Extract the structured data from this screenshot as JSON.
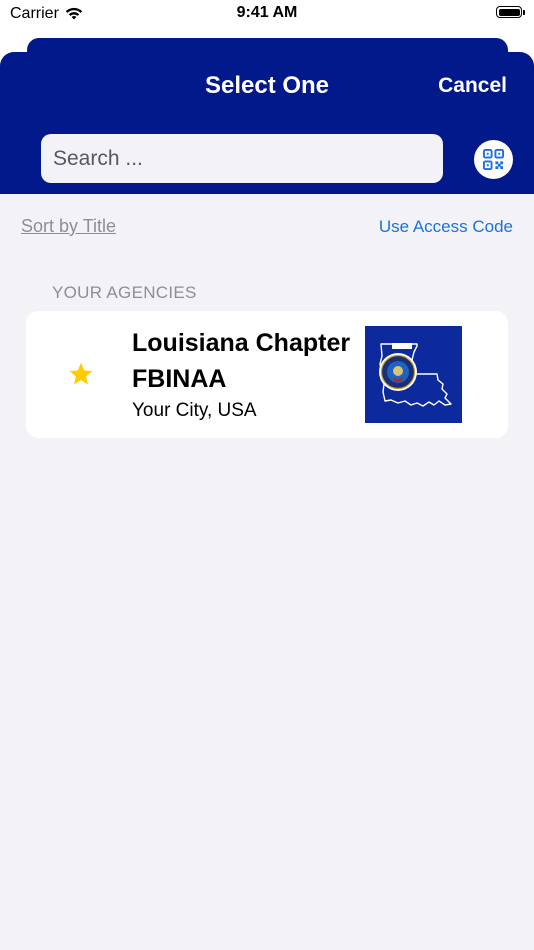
{
  "status_bar": {
    "carrier": "Carrier",
    "time": "9:41 AM",
    "icons": [
      "wifi-icon",
      "battery-icon"
    ]
  },
  "sheet": {
    "title": "Select One",
    "cancel_label": "Cancel",
    "search": {
      "placeholder": "Search ...",
      "value": ""
    },
    "qr_button_icon": "qr-code-icon",
    "sort_label": "Sort by Title",
    "access_code_label": "Use Access Code",
    "section_header": "YOUR AGENCIES"
  },
  "agencies": [
    {
      "name": "Louisiana Chapter FBINAA",
      "location": "Your City, USA",
      "favorite_icon": "star-icon",
      "logo_icon": "louisiana-seal-logo"
    }
  ],
  "colors": {
    "header_bg": "#02198b",
    "background": "#f2f2f7",
    "link_blue": "#1a73d9",
    "star": "#ffcc00",
    "secondary_text": "#8e8e93"
  }
}
